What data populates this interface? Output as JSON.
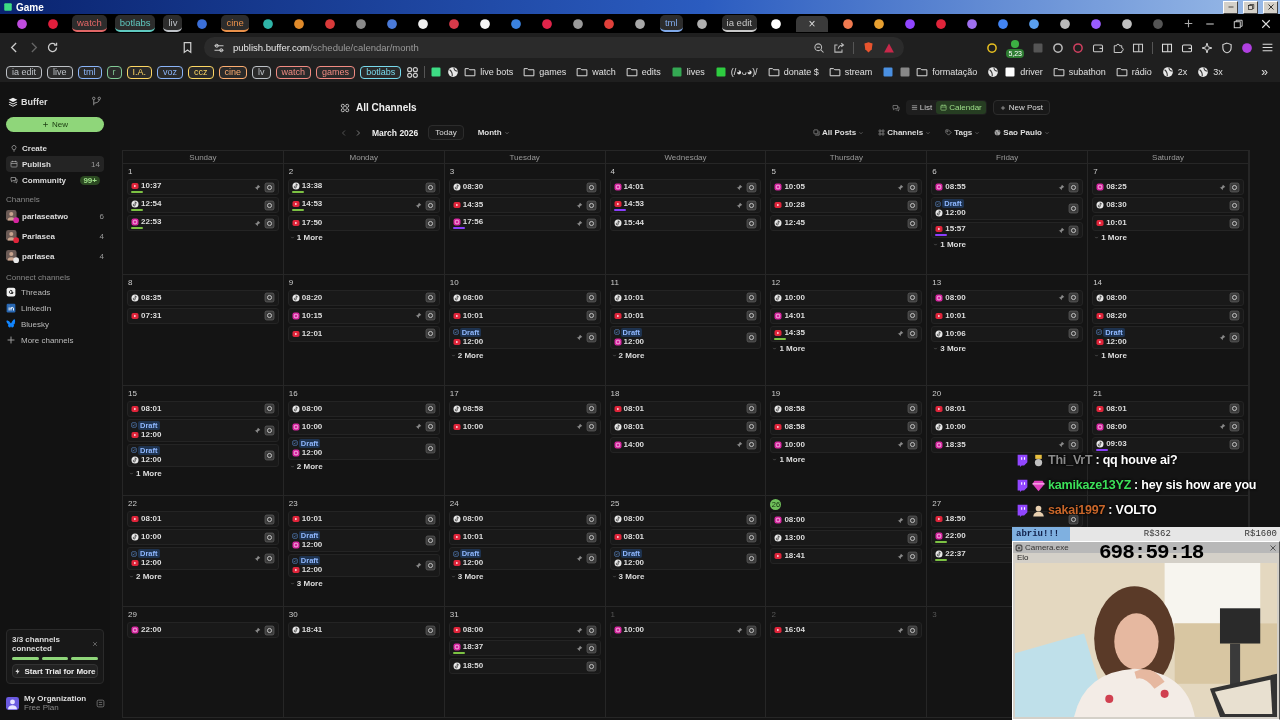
{
  "window": {
    "title": "Game"
  },
  "tabs": [
    {
      "kind": "icon",
      "color": "#c04cdf",
      "selected": false
    },
    {
      "kind": "icon",
      "color": "#e01e3c",
      "selected": false
    },
    {
      "kind": "group",
      "label": "watch",
      "color": "#e06666",
      "selected": false
    },
    {
      "kind": "group",
      "label": "botlabs",
      "color": "#5fc9c0",
      "selected": false
    },
    {
      "kind": "group",
      "label": "liv",
      "color": "#bdc1c6",
      "selected": false
    },
    {
      "kind": "icon",
      "color": "#3b6fd8",
      "selected": false
    },
    {
      "kind": "group",
      "label": "cine",
      "color": "#e8904a",
      "selected": false
    },
    {
      "kind": "icon",
      "color": "#2fb5a8",
      "selected": false
    },
    {
      "kind": "icon",
      "color": "#e08a2a",
      "selected": false
    },
    {
      "kind": "icon",
      "color": "#d93a3a",
      "selected": false
    },
    {
      "kind": "icon",
      "color": "#8a8a8a",
      "selected": false
    },
    {
      "kind": "icon",
      "color": "#4a7ad8",
      "selected": false
    },
    {
      "kind": "icon",
      "color": "#f0f0f0",
      "selected": false
    },
    {
      "kind": "icon",
      "color": "#d83a4a",
      "selected": false
    },
    {
      "kind": "icon",
      "color": "#f5f5f5",
      "selected": false
    },
    {
      "kind": "icon",
      "color": "#3a82e0",
      "selected": false
    },
    {
      "kind": "icon",
      "color": "#e0244a",
      "selected": false
    },
    {
      "kind": "icon",
      "color": "#9a9a9a",
      "selected": false
    },
    {
      "kind": "icon",
      "color": "#e0403a",
      "selected": false
    },
    {
      "kind": "icon",
      "color": "#a8a8a8",
      "selected": false
    },
    {
      "kind": "group",
      "label": "tml",
      "color": "#7fa8e8",
      "selected": false
    },
    {
      "kind": "icon",
      "color": "#b0b0b0",
      "selected": false
    },
    {
      "kind": "group",
      "label": "ia edit",
      "color": "#c8c8c8",
      "selected": false
    },
    {
      "kind": "icon",
      "color": "#ffffff",
      "selected": false
    },
    {
      "kind": "active",
      "close": "×",
      "selected": true
    },
    {
      "kind": "icon",
      "color": "#f07a50",
      "selected": false
    },
    {
      "kind": "icon",
      "color": "#e8a030",
      "selected": false
    },
    {
      "kind": "icon",
      "color": "#9146ff",
      "selected": false
    },
    {
      "kind": "icon",
      "color": "#e0243a",
      "selected": false
    },
    {
      "kind": "icon",
      "color": "#a070f0",
      "selected": false
    },
    {
      "kind": "icon",
      "color": "#4285f4",
      "selected": false
    },
    {
      "kind": "icon",
      "color": "#5aa0f0",
      "selected": false
    },
    {
      "kind": "icon",
      "color": "#bbbbbb",
      "selected": false
    },
    {
      "kind": "icon",
      "color": "#9a5cff",
      "selected": false
    },
    {
      "kind": "icon",
      "color": "#c0c0c0",
      "selected": false
    },
    {
      "kind": "icon",
      "color": "#555555",
      "selected": false
    }
  ],
  "address_bar": {
    "host": "publish.buffer.com",
    "path": "/schedule/calendar/month",
    "extension_badge": "5,23"
  },
  "bookmarks": [
    {
      "kind": "chip",
      "label": "ia edit",
      "color": "#bdc1c6"
    },
    {
      "kind": "chip",
      "label": "live",
      "color": "#bdc1c6"
    },
    {
      "kind": "chip",
      "label": "tml",
      "color": "#8ab4f8"
    },
    {
      "kind": "chip",
      "label": "r",
      "color": "#81c995"
    },
    {
      "kind": "chip",
      "label": "I.A.",
      "color": "#fdd663"
    },
    {
      "kind": "chip",
      "label": "voz",
      "color": "#8ab4f8"
    },
    {
      "kind": "chip",
      "label": "ccz",
      "color": "#fdd663"
    },
    {
      "kind": "chip",
      "label": "cine",
      "color": "#fcad70"
    },
    {
      "kind": "chip",
      "label": "lv",
      "color": "#bdc1c6"
    },
    {
      "kind": "chip",
      "label": "watch",
      "color": "#f28b82"
    },
    {
      "kind": "chip",
      "label": "games",
      "color": "#f28b82"
    },
    {
      "kind": "chip",
      "label": "botlabs",
      "color": "#78d9ec"
    },
    {
      "kind": "apps"
    },
    {
      "kind": "site",
      "color": "#3ddc84"
    },
    {
      "kind": "globe"
    },
    {
      "kind": "folder",
      "label": "live bots"
    },
    {
      "kind": "folder",
      "label": "games"
    },
    {
      "kind": "folder",
      "label": "watch"
    },
    {
      "kind": "folder",
      "label": "edits"
    },
    {
      "kind": "site",
      "label": "lives",
      "color": "#34a853"
    },
    {
      "kind": "site",
      "label": "(/◕ᴗ◕)/",
      "color": "#2ecc40"
    },
    {
      "kind": "folder",
      "label": "donate $"
    },
    {
      "kind": "folder",
      "label": "stream"
    },
    {
      "kind": "site",
      "color": "#4a90e2"
    },
    {
      "kind": "site",
      "color": "#888888"
    },
    {
      "kind": "folder",
      "label": "formatação"
    },
    {
      "kind": "globe"
    },
    {
      "kind": "site",
      "label": "driver",
      "color": "#ffffff"
    },
    {
      "kind": "folder",
      "label": "subathon"
    },
    {
      "kind": "folder",
      "label": "rádio"
    },
    {
      "kind": "globe",
      "label": "2x"
    },
    {
      "kind": "globe",
      "label": "3x"
    },
    {
      "kind": "overflow",
      "label": "»"
    }
  ],
  "sidebar": {
    "brand": "Buffer",
    "new_button": "New",
    "nav": [
      {
        "kind": "create",
        "label": "Create",
        "selected": false
      },
      {
        "kind": "publish",
        "label": "Publish",
        "count": "14",
        "selected": true
      },
      {
        "kind": "community",
        "label": "Community",
        "badge": "99+",
        "selected": false
      }
    ],
    "channels_heading": "Channels",
    "channels": [
      {
        "name": "parlaseatwo",
        "count": "6",
        "kind": "instagram"
      },
      {
        "name": "Parlasea",
        "count": "4",
        "kind": "youtube"
      },
      {
        "name": "parlasea",
        "count": "4",
        "kind": "tiktok"
      }
    ],
    "connect_heading": "Connect channels",
    "connect": [
      {
        "label": "Threads",
        "kind": "threads"
      },
      {
        "label": "LinkedIn",
        "kind": "linkedin"
      },
      {
        "label": "Bluesky",
        "kind": "bluesky"
      },
      {
        "label": "More channels",
        "kind": "more"
      }
    ],
    "trial": {
      "title": "3/3 channels connected",
      "level": 1,
      "button": "Start Trial for More"
    },
    "org": {
      "name": "My Organization",
      "plan": "Free Plan"
    }
  },
  "header": {
    "title": "All Channels",
    "views": [
      {
        "kind": "list",
        "label": "List",
        "selected": false
      },
      {
        "kind": "calendar",
        "label": "Calendar",
        "selected": true
      }
    ],
    "new_post": "New Post",
    "month": "March 2026",
    "today": "Today",
    "range": "Month",
    "filters": [
      {
        "kind": "posts",
        "label": "All Posts"
      },
      {
        "kind": "channels",
        "label": "Channels"
      },
      {
        "kind": "tags",
        "label": "Tags"
      },
      {
        "kind": "timezone",
        "label": "Sao Paulo"
      }
    ]
  },
  "calendar": {
    "weekdays": [
      "Sunday",
      "Monday",
      "Tuesday",
      "Wednesday",
      "Thursday",
      "Friday",
      "Saturday"
    ],
    "weeks": [
      [
        {
          "day": "1",
          "muted": false,
          "today": false,
          "posts": [
            {
              "kind": "youtube",
              "time": "10:37",
              "color": "#7cc243",
              "pin": true
            },
            {
              "kind": "tiktok",
              "time": "12:54",
              "color": "#7cc243",
              "pin": false
            },
            {
              "kind": "instagram",
              "time": "22:53",
              "color": "#7cc243",
              "pin": true
            }
          ]
        },
        {
          "day": "2",
          "muted": false,
          "today": false,
          "posts": [
            {
              "kind": "tiktok",
              "time": "13:38",
              "color": "#7cc243",
              "pin": false
            },
            {
              "kind": "youtube",
              "time": "14:53",
              "color": "#7cc243",
              "pin": true
            },
            {
              "kind": "youtube",
              "time": "17:50",
              "pin": false
            }
          ],
          "more": "1 More"
        },
        {
          "day": "3",
          "muted": false,
          "today": false,
          "posts": [
            {
              "kind": "tiktok",
              "time": "08:30",
              "pin": false
            },
            {
              "kind": "youtube",
              "time": "14:35",
              "pin": true
            },
            {
              "kind": "instagram",
              "time": "17:56",
              "color": "#8a3ffc",
              "pin": true
            }
          ]
        },
        {
          "day": "4",
          "muted": false,
          "today": false,
          "posts": [
            {
              "kind": "instagram",
              "time": "14:01",
              "pin": true
            },
            {
              "kind": "youtube",
              "time": "14:53",
              "color": "#8a3ffc",
              "pin": true
            },
            {
              "kind": "tiktok",
              "time": "15:44",
              "pin": false
            }
          ]
        },
        {
          "day": "5",
          "muted": false,
          "today": false,
          "posts": [
            {
              "kind": "instagram",
              "time": "10:05",
              "pin": true
            },
            {
              "kind": "youtube",
              "time": "10:28",
              "pin": false
            },
            {
              "kind": "tiktok",
              "time": "12:45",
              "pin": false
            }
          ]
        },
        {
          "day": "6",
          "muted": false,
          "today": false,
          "posts": [
            {
              "kind": "instagram",
              "time": "08:55",
              "pin": true
            },
            {
              "kind": "tiktok",
              "time": "12:00",
              "badge": "Draft",
              "pin": false
            },
            {
              "kind": "youtube",
              "time": "15:57",
              "color": "#8a3ffc",
              "pin": true
            }
          ],
          "more": "1 More"
        },
        {
          "day": "7",
          "muted": false,
          "today": false,
          "posts": [
            {
              "kind": "instagram",
              "time": "08:25",
              "pin": true
            },
            {
              "kind": "tiktok",
              "time": "08:30",
              "pin": false
            },
            {
              "kind": "youtube",
              "time": "10:01",
              "pin": false
            }
          ],
          "more": "1 More"
        }
      ],
      [
        {
          "day": "8",
          "muted": false,
          "today": false,
          "posts": [
            {
              "kind": "tiktok",
              "time": "08:35",
              "pin": false
            },
            {
              "kind": "youtube",
              "time": "07:31",
              "pin": false
            }
          ]
        },
        {
          "day": "9",
          "muted": false,
          "today": false,
          "posts": [
            {
              "kind": "tiktok",
              "time": "08:20",
              "pin": false
            },
            {
              "kind": "instagram",
              "time": "10:15",
              "pin": true
            },
            {
              "kind": "youtube",
              "time": "12:01",
              "pin": false
            }
          ]
        },
        {
          "day": "10",
          "muted": false,
          "today": false,
          "posts": [
            {
              "kind": "tiktok",
              "time": "08:00",
              "pin": false
            },
            {
              "kind": "youtube",
              "time": "10:01",
              "pin": false
            },
            {
              "kind": "youtube",
              "time": "12:00",
              "badge": "Draft",
              "pin": true
            }
          ],
          "more": "2 More"
        },
        {
          "day": "11",
          "muted": false,
          "today": false,
          "posts": [
            {
              "kind": "tiktok",
              "time": "10:01",
              "pin": false
            },
            {
              "kind": "youtube",
              "time": "10:01",
              "pin": false
            },
            {
              "kind": "instagram",
              "time": "12:00",
              "badge": "Draft",
              "pin": false
            }
          ],
          "more": "2 More"
        },
        {
          "day": "12",
          "muted": false,
          "today": false,
          "posts": [
            {
              "kind": "tiktok",
              "time": "10:00",
              "pin": false
            },
            {
              "kind": "instagram",
              "time": "14:01",
              "pin": false
            },
            {
              "kind": "youtube",
              "time": "14:35",
              "color": "#7cc243",
              "pin": true
            }
          ],
          "more": "1 More"
        },
        {
          "day": "13",
          "muted": false,
          "today": false,
          "posts": [
            {
              "kind": "instagram",
              "time": "08:00",
              "pin": true
            },
            {
              "kind": "youtube",
              "time": "10:01",
              "pin": false
            },
            {
              "kind": "tiktok",
              "time": "10:06",
              "pin": false
            }
          ],
          "more": "3 More"
        },
        {
          "day": "14",
          "muted": false,
          "today": false,
          "posts": [
            {
              "kind": "tiktok",
              "time": "08:00",
              "pin": false
            },
            {
              "kind": "youtube",
              "time": "08:20",
              "pin": false
            },
            {
              "kind": "youtube",
              "time": "12:00",
              "badge": "Draft",
              "pin": true
            }
          ],
          "more": "1 More"
        }
      ],
      [
        {
          "day": "15",
          "muted": false,
          "today": false,
          "posts": [
            {
              "kind": "youtube",
              "time": "08:01",
              "pin": false
            },
            {
              "kind": "youtube",
              "time": "12:00",
              "badge": "Draft",
              "pin": true
            },
            {
              "kind": "tiktok",
              "time": "12:00",
              "badge": "Draft",
              "pin": false
            }
          ],
          "more": "1 More"
        },
        {
          "day": "16",
          "muted": false,
          "today": false,
          "posts": [
            {
              "kind": "tiktok",
              "time": "08:00",
              "pin": false
            },
            {
              "kind": "instagram",
              "time": "10:00",
              "pin": true
            },
            {
              "kind": "instagram",
              "time": "12:00",
              "badge": "Draft",
              "pin": false
            }
          ],
          "more": "2 More"
        },
        {
          "day": "17",
          "muted": false,
          "today": false,
          "posts": [
            {
              "kind": "tiktok",
              "time": "08:58",
              "pin": false
            },
            {
              "kind": "youtube",
              "time": "10:00",
              "pin": true
            }
          ]
        },
        {
          "day": "18",
          "muted": false,
          "today": false,
          "posts": [
            {
              "kind": "youtube",
              "time": "08:01",
              "pin": false
            },
            {
              "kind": "tiktok",
              "time": "08:01",
              "pin": false
            },
            {
              "kind": "instagram",
              "time": "14:00",
              "pin": true
            }
          ]
        },
        {
          "day": "19",
          "muted": false,
          "today": false,
          "posts": [
            {
              "kind": "tiktok",
              "time": "08:58",
              "pin": false
            },
            {
              "kind": "youtube",
              "time": "08:58",
              "pin": false
            },
            {
              "kind": "instagram",
              "time": "10:00",
              "pin": true
            }
          ],
          "more": "1 More"
        },
        {
          "day": "20",
          "muted": false,
          "today": false,
          "posts": [
            {
              "kind": "youtube",
              "time": "08:01",
              "pin": false
            },
            {
              "kind": "tiktok",
              "time": "10:00",
              "pin": false
            },
            {
              "kind": "instagram",
              "time": "18:35",
              "pin": true
            }
          ]
        },
        {
          "day": "21",
          "muted": false,
          "today": false,
          "posts": [
            {
              "kind": "youtube",
              "time": "08:01",
              "pin": false
            },
            {
              "kind": "instagram",
              "time": "08:00",
              "pin": true
            },
            {
              "kind": "tiktok",
              "time": "09:03",
              "color": "#8a3ffc",
              "pin": false
            }
          ]
        }
      ],
      [
        {
          "day": "22",
          "muted": false,
          "today": false,
          "posts": [
            {
              "kind": "youtube",
              "time": "08:01",
              "pin": false
            },
            {
              "kind": "tiktok",
              "time": "10:00",
              "pin": false
            },
            {
              "kind": "youtube",
              "time": "12:00",
              "badge": "Draft",
              "pin": true
            }
          ],
          "more": "2 More"
        },
        {
          "day": "23",
          "muted": false,
          "today": false,
          "posts": [
            {
              "kind": "youtube",
              "time": "10:01",
              "pin": false
            },
            {
              "kind": "instagram",
              "time": "12:00",
              "badge": "Draft",
              "pin": false
            },
            {
              "kind": "youtube",
              "time": "12:00",
              "badge": "Draft",
              "pin": true
            }
          ],
          "more": "3 More"
        },
        {
          "day": "24",
          "muted": false,
          "today": false,
          "posts": [
            {
              "kind": "tiktok",
              "time": "08:00",
              "pin": false
            },
            {
              "kind": "youtube",
              "time": "10:01",
              "pin": false
            },
            {
              "kind": "youtube",
              "time": "12:00",
              "badge": "Draft",
              "pin": true
            }
          ],
          "more": "3 More"
        },
        {
          "day": "25",
          "muted": false,
          "today": false,
          "posts": [
            {
              "kind": "tiktok",
              "time": "08:00",
              "pin": false
            },
            {
              "kind": "youtube",
              "time": "08:01",
              "pin": false
            },
            {
              "kind": "tiktok",
              "time": "12:00",
              "badge": "Draft",
              "pin": false
            }
          ],
          "more": "3 More"
        },
        {
          "day": "26",
          "muted": false,
          "today": true,
          "posts": [
            {
              "kind": "instagram",
              "time": "08:00",
              "pin": true
            },
            {
              "kind": "tiktok",
              "time": "13:00",
              "pin": false
            },
            {
              "kind": "youtube",
              "time": "18:41",
              "pin": true
            }
          ]
        },
        {
          "day": "27",
          "muted": false,
          "today": false,
          "posts": [
            {
              "kind": "youtube",
              "time": "18:50",
              "pin": false
            },
            {
              "kind": "instagram",
              "time": "22:00",
              "color": "#7cc243",
              "pin": false,
              "thumbnail": false
            },
            {
              "kind": "tiktok",
              "time": "22:37",
              "color": "#7cc243",
              "pin": false,
              "thumbnail": false
            }
          ]
        }
      ],
      [
        {
          "day": "29",
          "muted": false,
          "today": false,
          "posts": [
            {
              "kind": "instagram",
              "time": "22:00",
              "pin": true
            }
          ]
        },
        {
          "day": "30",
          "muted": false,
          "today": false,
          "posts": [
            {
              "kind": "tiktok",
              "time": "18:41",
              "pin": false
            }
          ]
        },
        {
          "day": "31",
          "muted": false,
          "today": false,
          "posts": [
            {
              "kind": "youtube",
              "time": "08:00",
              "pin": true
            },
            {
              "kind": "instagram",
              "time": "18:37",
              "color": "#7cc243",
              "pin": true
            },
            {
              "kind": "tiktok",
              "time": "18:50",
              "pin": false
            }
          ]
        },
        {
          "day": "1",
          "muted": true,
          "today": false,
          "posts": [
            {
              "kind": "instagram",
              "time": "10:00",
              "pin": true
            }
          ]
        },
        {
          "day": "2",
          "muted": true,
          "today": false,
          "posts": [
            {
              "kind": "youtube",
              "time": "16:04",
              "pin": true
            }
          ]
        },
        {
          "day": "3",
          "muted": true,
          "today": false
        }
      ]
    ]
  },
  "chat": [
    {
      "kind": "sub",
      "user": "Thi_VrT",
      "text": ": qq houve ai?",
      "color": "#8a8a8a"
    },
    {
      "kind": "gem",
      "user": "kamikaze13YZ",
      "text": ": hey sis how are you",
      "color": "#3de05a"
    },
    {
      "kind": "avatar",
      "user": "sakai1997",
      "text": ": VOLTO",
      "color": "#c8662a"
    }
  ],
  "stream_bar": {
    "goal": "abriu!!!",
    "amounts": [
      "R$362",
      "R$1600"
    ]
  },
  "camera": {
    "title": "Camera.exe",
    "menu": "Elo",
    "timer": "698:59:18"
  }
}
